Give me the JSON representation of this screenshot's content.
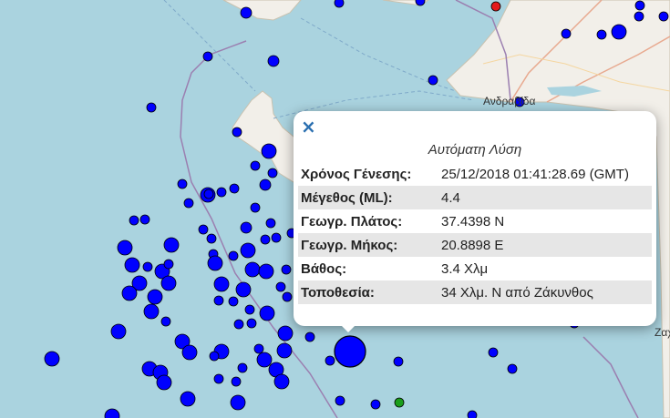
{
  "map": {
    "place_labels": {
      "andravida": "Ανδραβίδα",
      "zakynthos_partial": "Ζαχ"
    },
    "colors": {
      "sea": "#aad3df",
      "land": "#f2efe9",
      "quake": "#0000ff",
      "recent_quake": "#e41a1c",
      "green_quake": "#1a9e1a"
    }
  },
  "popup": {
    "close_label": "×",
    "title": "Αυτόματη Λύση",
    "rows": [
      {
        "label": "Χρόνος Γένεσης:",
        "value": "25/12/2018 01:41:28.69 (GMT)"
      },
      {
        "label": "Μέγεθος (ML):",
        "value": "4.4"
      },
      {
        "label": "Γεωγρ. Πλάτος:",
        "value": "37.4398 N"
      },
      {
        "label": "Γεωγρ. Μήκος:",
        "value": "20.8898 E"
      },
      {
        "label": "Βάθος:",
        "value": "3.4 Χλμ"
      },
      {
        "label": "Τοποθεσία:",
        "value": "34 Χλμ. Ν από Ζάκυνθος"
      }
    ]
  }
}
